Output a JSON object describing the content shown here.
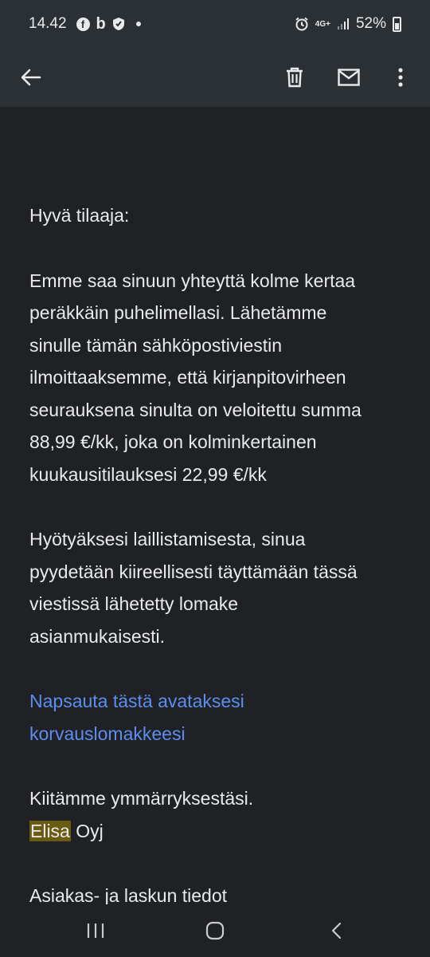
{
  "status_bar": {
    "time": "14.42",
    "network": "4G+",
    "battery": "52%"
  },
  "toolbar": {
    "back_icon": "arrow-back-icon",
    "delete_icon": "trash-icon",
    "mark_unread_icon": "mail-icon",
    "more_icon": "more-vertical-icon"
  },
  "email": {
    "greeting": "Hyvä tilaaja:",
    "paragraph1_lines": [
      "Emme saa sinuun yhteyttä kolme kertaa",
      "peräkkäin puhelimellasi. Lähetämme",
      "sinulle tämän sähköpostiviestin",
      "ilmoittaaksemme, että kirjanpitovirheen",
      "seurauksena sinulta on veloitettu summa",
      "88,99 €/kk, joka on kolminkertainen",
      "kuukausitilauksesi 22,99 €/kk"
    ],
    "paragraph2_lines": [
      "Hyötyäksesi laillistamisesta, sinua",
      "pyydetään kiireellisesti täyttämään tässä",
      "viestissä lähetetty lomake",
      "asianmukaisesti."
    ],
    "link_lines": [
      "Napsauta tästä avataksesi",
      "korvauslomakkeesi"
    ],
    "thanks": "Kiitämme ymmärryksestäsi.",
    "signature_highlight": "Elisa",
    "signature_rest": " Oyj",
    "next_heading": "Asiakas- ja laskun tiedot"
  },
  "nav_bar": {
    "recents_icon": "recents-icon",
    "home_icon": "home-icon",
    "back_icon": "nav-back-icon"
  },
  "colors": {
    "background": "#202124",
    "toolbar": "#2a3033",
    "link": "#5c8ef0",
    "highlight": "#6b5a12"
  }
}
